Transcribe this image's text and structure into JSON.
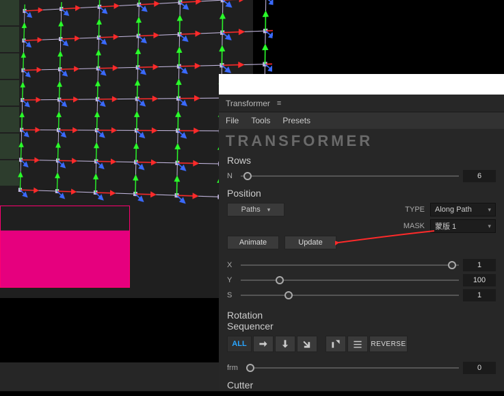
{
  "panel_title": "Transformer",
  "brand": "TRANSFORMER",
  "menubar": {
    "file": "File",
    "tools": "Tools",
    "presets": "Presets"
  },
  "rows": {
    "heading": "Rows",
    "n_label": "N",
    "n_value": "6",
    "n_knob_pct": 3
  },
  "position": {
    "heading": "Position",
    "paths_label": "Paths",
    "type_label": "TYPE",
    "type_value": "Along Path",
    "mask_label": "MASK",
    "mask_value": "蒙版 1",
    "animate_label": "Animate",
    "update_label": "Update",
    "x": {
      "label": "X",
      "value": "1",
      "knob_pct": 97
    },
    "y": {
      "label": "Y",
      "value": "100",
      "knob_pct": 18
    },
    "s": {
      "label": "S",
      "value": "1",
      "knob_pct": 22
    }
  },
  "rotation_heading": "Rotation",
  "sequencer": {
    "heading": "Sequencer",
    "all_label": "ALL",
    "reverse_label": "REVERSE",
    "frm_label": "frm",
    "frm_value": "0",
    "frm_knob_pct": 2,
    "icons": [
      "arrow-right",
      "arrow-down",
      "arrow-down-right",
      "corner-up",
      "lines"
    ]
  },
  "cutter_heading": "Cutter"
}
